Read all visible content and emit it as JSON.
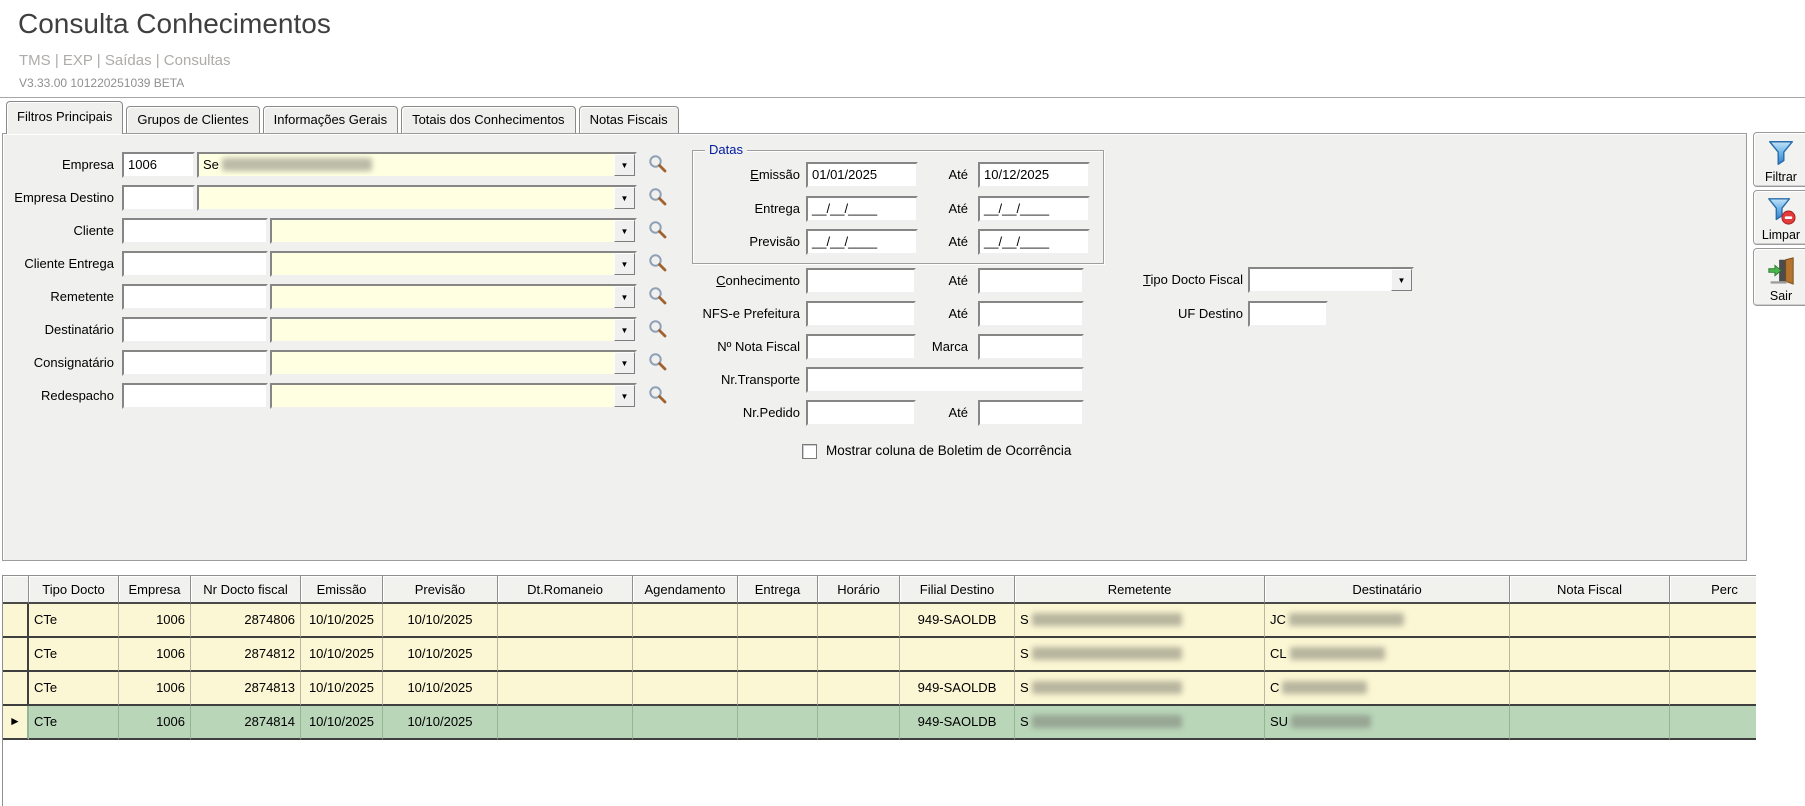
{
  "header": {
    "title": "Consulta Conhecimentos",
    "breadcrumb": "TMS | EXP | Saídas | Consultas",
    "version": "V3.33.00 101220251039 BETA"
  },
  "tabs": [
    {
      "label": "Filtros Principais",
      "active": true
    },
    {
      "label": "Grupos de Clientes",
      "active": false
    },
    {
      "label": "Informações Gerais",
      "active": false
    },
    {
      "label": "Totais dos Conhecimentos",
      "active": false
    },
    {
      "label": "Notas Fiscais",
      "active": false
    }
  ],
  "filters": {
    "entity_rows": [
      {
        "label": "Empresa",
        "code": "1006",
        "name_prefix": "Se",
        "name_blurred": true,
        "narrow": true
      },
      {
        "label": "Empresa Destino",
        "code": "",
        "name_prefix": "",
        "name_blurred": false,
        "narrow": true
      },
      {
        "label": "Cliente",
        "code": "",
        "name_prefix": "",
        "name_blurred": false,
        "narrow": false
      },
      {
        "label": "Cliente Entrega",
        "code": "",
        "name_prefix": "",
        "name_blurred": false,
        "narrow": false
      },
      {
        "label": "Remetente",
        "code": "",
        "name_prefix": "",
        "name_blurred": false,
        "narrow": false
      },
      {
        "label": "Destinatário",
        "code": "",
        "name_prefix": "",
        "name_blurred": false,
        "narrow": false
      },
      {
        "label": "Consignatário",
        "code": "",
        "name_prefix": "",
        "name_blurred": false,
        "narrow": false
      },
      {
        "label": "Redespacho",
        "code": "",
        "name_prefix": "",
        "name_blurred": false,
        "narrow": false
      }
    ],
    "datas_group": {
      "title": "Datas",
      "rows": [
        {
          "label": "Emissão",
          "underline_first": true,
          "from": "01/01/2025",
          "ate_label": "Até",
          "to": "10/12/2025"
        },
        {
          "label": "Entrega",
          "underline_first": false,
          "from": "__/__/____",
          "ate_label": "Até",
          "to": "__/__/____"
        },
        {
          "label": "Previsão",
          "underline_first": false,
          "from": "__/__/____",
          "ate_label": "Até",
          "to": "__/__/____"
        }
      ]
    },
    "doc_rows": [
      {
        "label": "Conhecimento",
        "underline_first": true,
        "layout": "pair",
        "second_label": "Até",
        "from": "",
        "to": ""
      },
      {
        "label": "NFS-e Prefeitura",
        "underline_first": false,
        "layout": "pair",
        "second_label": "Até",
        "from": "",
        "to": ""
      },
      {
        "label": "Nº Nota Fiscal",
        "underline_first": false,
        "layout": "pair",
        "second_label": "Marca",
        "from": "",
        "to": ""
      },
      {
        "label": "Nr.Transporte",
        "underline_first": false,
        "layout": "wide",
        "from": ""
      },
      {
        "label": "Nr.Pedido",
        "underline_first": false,
        "layout": "pair",
        "second_label": "Até",
        "from": "",
        "to": ""
      }
    ],
    "tipo_docto": {
      "label": "Tipo Docto Fiscal",
      "underline_first": true,
      "value": ""
    },
    "uf_destino": {
      "label": "UF Destino",
      "value": ""
    },
    "checkbox": {
      "label": "Mostrar coluna de Boletim de Ocorrência",
      "checked": false
    }
  },
  "actions": [
    {
      "label": "Filtrar",
      "icon": "filter-icon"
    },
    {
      "label": "Limpar",
      "icon": "filter-clear-icon"
    },
    {
      "label": "Sair",
      "icon": "exit-door-icon"
    }
  ],
  "grid": {
    "columns": [
      {
        "key": "tipo",
        "label": "Tipo Docto"
      },
      {
        "key": "empresa",
        "label": "Empresa"
      },
      {
        "key": "nr_docto",
        "label": "Nr Docto fiscal"
      },
      {
        "key": "emissao",
        "label": "Emissão"
      },
      {
        "key": "previsao",
        "label": "Previsão"
      },
      {
        "key": "dt_romaneio",
        "label": "Dt.Romaneio"
      },
      {
        "key": "agendamento",
        "label": "Agendamento"
      },
      {
        "key": "entrega",
        "label": "Entrega"
      },
      {
        "key": "horario",
        "label": "Horário"
      },
      {
        "key": "filial_destino",
        "label": "Filial Destino"
      },
      {
        "key": "remetente",
        "label": "Remetente"
      },
      {
        "key": "destinatario",
        "label": "Destinatário"
      },
      {
        "key": "nota_fiscal",
        "label": "Nota Fiscal"
      },
      {
        "key": "perc",
        "label": "Perc"
      }
    ],
    "rows": [
      {
        "selected": false,
        "tipo": "CTe",
        "empresa": "1006",
        "nr_docto": "2874806",
        "emissao": "10/10/2025",
        "previsao": "10/10/2025",
        "dt_romaneio": "",
        "agendamento": "",
        "entrega": "",
        "horario": "",
        "filial_destino": "949-SAOLDB",
        "remetente_prefix": "S",
        "remetente_blurred": true,
        "destinatario_prefix": "JC",
        "destinatario_blurred": true,
        "nota_fiscal": "",
        "perc": ""
      },
      {
        "selected": false,
        "tipo": "CTe",
        "empresa": "1006",
        "nr_docto": "2874812",
        "emissao": "10/10/2025",
        "previsao": "10/10/2025",
        "dt_romaneio": "",
        "agendamento": "",
        "entrega": "",
        "horario": "",
        "filial_destino": "",
        "remetente_prefix": "S",
        "remetente_blurred": true,
        "destinatario_prefix": "CL",
        "destinatario_blurred": true,
        "nota_fiscal": "",
        "perc": ""
      },
      {
        "selected": false,
        "tipo": "CTe",
        "empresa": "1006",
        "nr_docto": "2874813",
        "emissao": "10/10/2025",
        "previsao": "10/10/2025",
        "dt_romaneio": "",
        "agendamento": "",
        "entrega": "",
        "horario": "",
        "filial_destino": "949-SAOLDB",
        "remetente_prefix": "S",
        "remetente_blurred": true,
        "destinatario_prefix": "C",
        "destinatario_blurred": true,
        "nota_fiscal": "",
        "perc": ""
      },
      {
        "selected": true,
        "tipo": "CTe",
        "empresa": "1006",
        "nr_docto": "2874814",
        "emissao": "10/10/2025",
        "previsao": "10/10/2025",
        "dt_romaneio": "",
        "agendamento": "",
        "entrega": "",
        "horario": "",
        "filial_destino": "949-SAOLDB",
        "remetente_prefix": "S",
        "remetente_blurred": true,
        "destinatario_prefix": "SU",
        "destinatario_blurred": true,
        "nota_fiscal": "",
        "perc": ""
      }
    ]
  },
  "colors": {
    "panel_bg": "#f0f0ee",
    "combo_yellow": "#ffffe1",
    "row_yellow": "#fbf6d3",
    "row_selected_green": "#b9d6b9",
    "group_title_navy": "#001b9e"
  }
}
